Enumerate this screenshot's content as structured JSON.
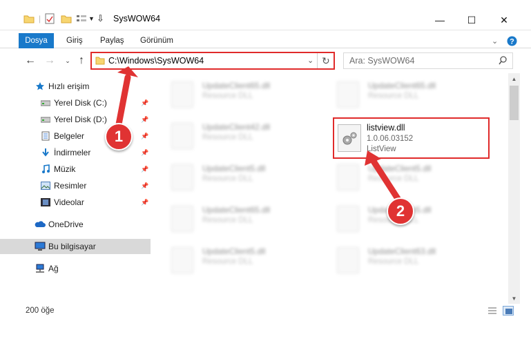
{
  "window": {
    "title": "SysWOW64",
    "controls": {
      "minimize": "—",
      "maximize": "☐",
      "close": "✕"
    }
  },
  "ribbon": {
    "tabs": [
      "Dosya",
      "Giriş",
      "Paylaş",
      "Görünüm"
    ]
  },
  "address": {
    "path": "C:\\Windows\\SysWOW64",
    "search_placeholder": "Ara: SysWOW64"
  },
  "nav": {
    "items": [
      {
        "label": "Hızlı erişim",
        "icon": "star-icon"
      },
      {
        "label": "Yerel Disk (C:)",
        "icon": "drive-icon",
        "pinned": true
      },
      {
        "label": "Yerel Disk (D:)",
        "icon": "drive-icon",
        "pinned": true
      },
      {
        "label": "Belgeler",
        "icon": "documents-icon",
        "pinned": true
      },
      {
        "label": "İndirmeler",
        "icon": "download-icon",
        "pinned": true
      },
      {
        "label": "Müzik",
        "icon": "music-icon",
        "pinned": true
      },
      {
        "label": "Resimler",
        "icon": "pictures-icon",
        "pinned": true
      },
      {
        "label": "Videolar",
        "icon": "videos-icon",
        "pinned": true
      },
      {
        "label": "OneDrive",
        "icon": "cloud-icon"
      },
      {
        "label": "Bu bilgisayar",
        "icon": "computer-icon",
        "selected": true
      },
      {
        "label": "Ağ",
        "icon": "network-icon"
      }
    ]
  },
  "files": {
    "left_column": [
      {
        "name": "UpdateClient65.dll",
        "desc": "Resource DLL"
      },
      {
        "name": "UpdateClient42.dll",
        "desc": "Resource DLL"
      },
      {
        "name": "UpdateClient5.dll",
        "desc": "Resource DLL"
      },
      {
        "name": "UpdateClient65.dll",
        "desc": "Resource DLL"
      },
      {
        "name": "UpdateClient5.dll",
        "desc": "Resource DLL"
      }
    ],
    "right_column": [
      {
        "name": "UpdateClient65.dll",
        "desc": "Resource DLL"
      },
      {
        "name": "UpdateClient5.dll",
        "desc": "Resource DLL"
      },
      {
        "name": "UpdateClient5.dll",
        "desc": "Resource DLL"
      },
      {
        "name": "UpdateClient63.dll",
        "desc": "Resource DLL"
      }
    ],
    "highlighted": {
      "name": "listview.dll",
      "version": "1.0.06.03152",
      "description": "ListView"
    }
  },
  "status": {
    "count": "200 öğe"
  },
  "callouts": {
    "one": "1",
    "two": "2"
  },
  "colors": {
    "accent": "#1979ca",
    "highlight": "#e02a2a",
    "callout": "#e03333"
  }
}
